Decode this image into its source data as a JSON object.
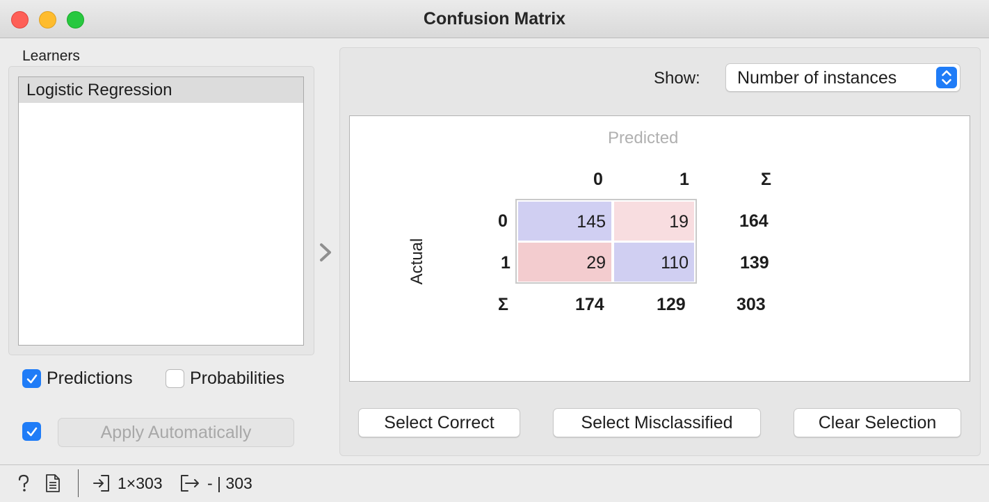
{
  "window": {
    "title": "Confusion Matrix"
  },
  "learners": {
    "label": "Learners",
    "items": [
      "Logistic Regression"
    ]
  },
  "output_options": {
    "predictions_label": "Predictions",
    "predictions_checked": true,
    "probabilities_label": "Probabilities",
    "probabilities_checked": false
  },
  "apply": {
    "auto_checked": true,
    "button_label": "Apply Automatically"
  },
  "show": {
    "label": "Show:",
    "selected": "Number of instances"
  },
  "matrix": {
    "predicted_label": "Predicted",
    "actual_label": "Actual",
    "col_headers": [
      "0",
      "1",
      "Σ"
    ],
    "row_headers": [
      "0",
      "1",
      "Σ"
    ],
    "cells": [
      [
        "145",
        "19"
      ],
      [
        "29",
        "110"
      ]
    ],
    "row_totals": [
      "164",
      "139"
    ],
    "col_totals": [
      "174",
      "129"
    ],
    "grand_total": "303",
    "colors": {
      "correct": "#d0cff2",
      "wrong_light": "#f8dde0",
      "wrong_strong": "#f3cccf"
    }
  },
  "buttons": {
    "select_correct": "Select Correct",
    "select_misclassified": "Select Misclassified",
    "clear_selection": "Clear Selection"
  },
  "status": {
    "input_summary": "1×303",
    "output_summary": "- | 303"
  }
}
